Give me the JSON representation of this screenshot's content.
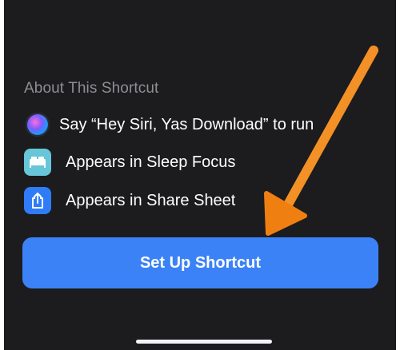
{
  "about": {
    "title": "About This Shortcut",
    "items": [
      {
        "label": "Say “Hey Siri, Yas Download” to run",
        "icon": "siri-icon"
      },
      {
        "label": "Appears in Sleep Focus",
        "icon": "bed-icon"
      },
      {
        "label": "Appears in Share Sheet",
        "icon": "share-icon"
      }
    ]
  },
  "cta": {
    "label": "Set Up Shortcut"
  },
  "colors": {
    "background": "#1c1c1e",
    "button": "#3b82f6",
    "secondaryText": "#8e8e93",
    "annotationArrow": "#f28a1b",
    "bedIconBg": "#67c6d8",
    "shareIconBg": "#2f7cf6"
  }
}
